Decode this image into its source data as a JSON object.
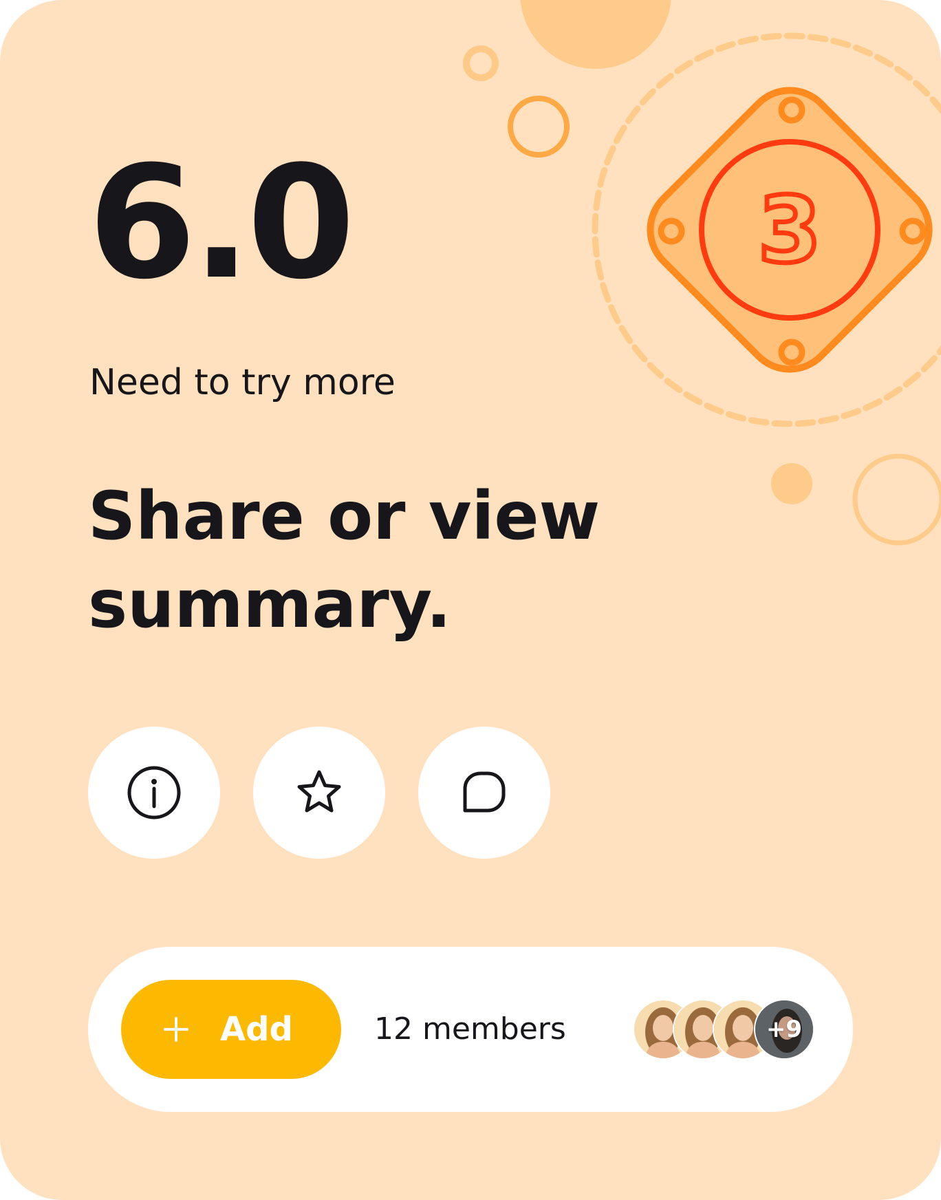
{
  "score": "6.0",
  "status_text": "Need to try more",
  "headline": "Share or view summary.",
  "badge": {
    "level_number": "3",
    "icon": "level-badge-icon"
  },
  "actions": [
    {
      "name": "info",
      "icon": "info-icon"
    },
    {
      "name": "favorite",
      "icon": "star-icon"
    },
    {
      "name": "comment",
      "icon": "chat-bubble-icon"
    }
  ],
  "members": {
    "add_label": "Add",
    "add_icon": "plus-icon",
    "count_label": "12 members",
    "more_label": "+9"
  },
  "colors": {
    "card_background": "#ffe1bf",
    "accent_button": "#fdb900",
    "badge_orange": "#ff8a1e",
    "badge_red": "#ff3b0f",
    "text_primary": "#17161a"
  }
}
